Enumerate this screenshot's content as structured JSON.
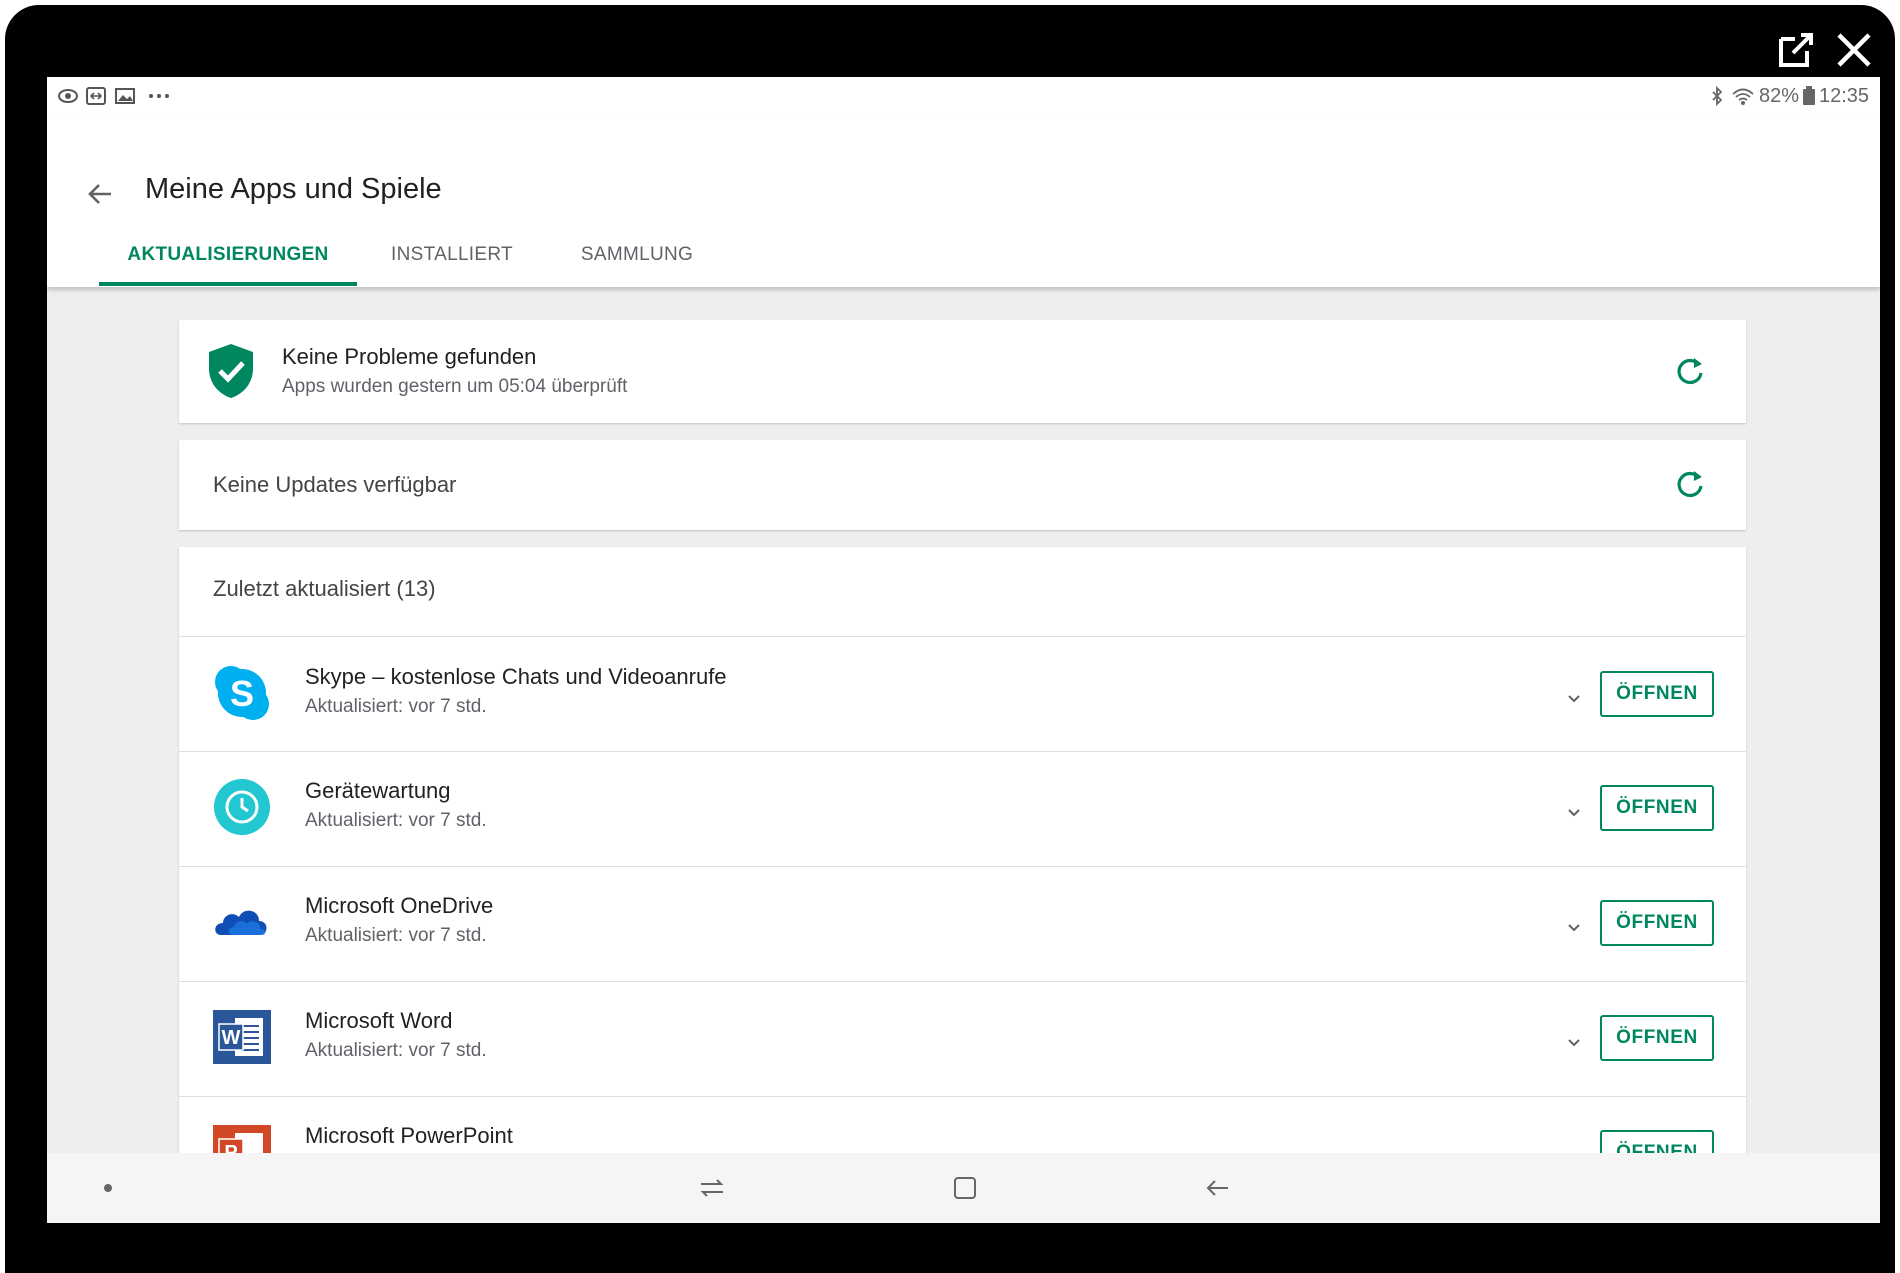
{
  "window": {
    "popout_icon": "external-link-icon",
    "close_icon": "close-icon"
  },
  "status_bar": {
    "left_icons": [
      "eye-icon",
      "screen-mirror-icon",
      "image-icon",
      "more-dots-icon"
    ],
    "battery": "82%",
    "time": "12:35"
  },
  "header": {
    "title": "Meine Apps und Spiele",
    "tabs": [
      {
        "label": "AKTUALISIERUNGEN",
        "active": true
      },
      {
        "label": "INSTALLIERT",
        "active": false
      },
      {
        "label": "SAMMLUNG",
        "active": false
      }
    ]
  },
  "protect": {
    "title": "Keine Probleme gefunden",
    "subtitle": "Apps wurden gestern um 05:04 überprüft"
  },
  "updates": {
    "label": "Keine Updates verfügbar"
  },
  "recent": {
    "header": "Zuletzt aktualisiert (13)",
    "apps": [
      {
        "name": "Skype – kostenlose Chats und Videoanrufe",
        "status": "Aktualisiert: vor 7 std.",
        "button": "ÖFFNEN"
      },
      {
        "name": "Gerätewartung",
        "status": "Aktualisiert: vor 7 std.",
        "button": "ÖFFNEN"
      },
      {
        "name": "Microsoft OneDrive",
        "status": "Aktualisiert: vor 7 std.",
        "button": "ÖFFNEN"
      },
      {
        "name": "Microsoft Word",
        "status": "Aktualisiert: vor 7 std.",
        "button": "ÖFFNEN"
      },
      {
        "name": "Microsoft PowerPoint",
        "status": "",
        "button": "ÖFFNEN"
      }
    ]
  },
  "colors": {
    "accent": "#01875f",
    "frame": "#000000",
    "background": "#eeeeee"
  }
}
